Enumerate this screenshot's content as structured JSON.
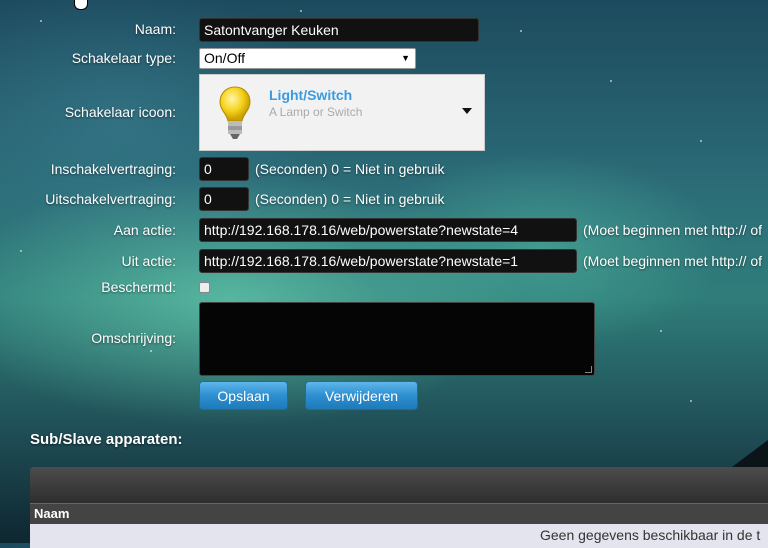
{
  "form": {
    "naam": {
      "label": "Naam:",
      "value": "Satontvanger Keuken"
    },
    "schakelaar_type": {
      "label": "Schakelaar type:",
      "selected": "On/Off"
    },
    "schakelaar_icoon": {
      "label": "Schakelaar icoon:",
      "title": "Light/Switch",
      "subtitle": "A Lamp or Switch",
      "icon": "lightbulb-icon"
    },
    "inschakelvertraging": {
      "label": "Inschakelvertraging:",
      "value": "0",
      "hint": "(Seconden) 0 = Niet in gebruik"
    },
    "uitschakelvertraging": {
      "label": "Uitschakelvertraging:",
      "value": "0",
      "hint": "(Seconden) 0 = Niet in gebruik"
    },
    "aan_actie": {
      "label": "Aan actie:",
      "value": "http://192.168.178.16/web/powerstate?newstate=4",
      "hint": "(Moet beginnen met http:// of"
    },
    "uit_actie": {
      "label": "Uit actie:",
      "value": "http://192.168.178.16/web/powerstate?newstate=1",
      "hint": "(Moet beginnen met http:// of"
    },
    "beschermd": {
      "label": "Beschermd:",
      "checked": false
    },
    "omschrijving": {
      "label": "Omschrijving:",
      "value": ""
    }
  },
  "buttons": {
    "save": "Opslaan",
    "delete": "Verwijderen"
  },
  "sub_slave": {
    "title": "Sub/Slave apparaten:",
    "columns": [
      "Naam"
    ],
    "empty_text": "Geen gegevens beschikbaar in de t"
  },
  "colors": {
    "button_blue": "#2d8fd1",
    "icon_title": "#3a9be0"
  }
}
